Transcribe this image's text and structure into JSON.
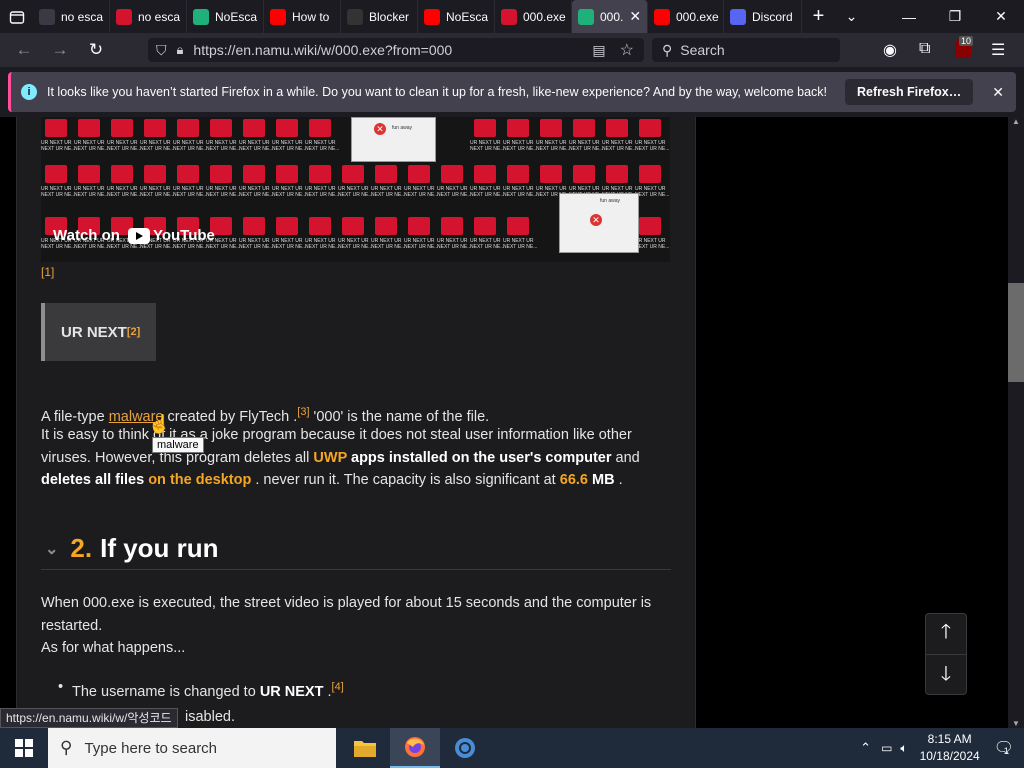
{
  "tabs": [
    {
      "label": "no esca",
      "color": "#3a3a44",
      "icon": "search-icon"
    },
    {
      "label": "no esca",
      "color": "#d4142e",
      "icon": "namu-icon"
    },
    {
      "label": "NoEsca",
      "color": "#20b07a",
      "icon": "noesc-icon"
    },
    {
      "label": "How to",
      "color": "#ff0000",
      "icon": "youtube-icon"
    },
    {
      "label": "Blocker",
      "color": "#333",
      "icon": "blocker-icon"
    },
    {
      "label": "NoEsca",
      "color": "#ff0000",
      "icon": "youtube-icon"
    },
    {
      "label": "000.exe",
      "color": "#d4142e",
      "icon": "namu-icon"
    },
    {
      "label": "000.",
      "color": "#20b07a",
      "icon": "noesc-icon",
      "active": true
    },
    {
      "label": "000.exe",
      "color": "#ff0000",
      "icon": "youtube-icon"
    },
    {
      "label": "Discord",
      "color": "#5865f2",
      "icon": "discord-icon"
    }
  ],
  "url": "https://en.namu.wiki/w/000.exe?from=000",
  "url_host": "namu.wiki",
  "search_placeholder": "Search",
  "extension_badge": "10",
  "notification": {
    "text": "It looks like you haven’t started Firefox in a while. Do you want to clean it up for a fresh, like-new experience? And by the way, welcome back!",
    "button": "Refresh Firefox…"
  },
  "video": {
    "watch_on": "Watch on",
    "youtube": "YouTube",
    "tile_label": "UR NEXT UR NEXT UR NE...",
    "dialog_text": "fun away"
  },
  "footnote1": "[1]",
  "urnext": {
    "title": "UR NEXT",
    "fn": "[2]"
  },
  "para1": {
    "a": "A file-type ",
    "link": "malware",
    "b": " created by FlyTech .",
    "fn": "[3]",
    "c": " '000' is the name of the file."
  },
  "para2": {
    "a": "It is easy to think of it as a joke program because it does not steal user information like other viruses. However, this program deletes all ",
    "uwp": "UWP",
    "b": " apps installed on the user's computer",
    "c": " and ",
    "d": "deletes all files",
    "e": " on the desktop",
    "f": " . never run it. The capacity is also significant at ",
    "g": "66.6",
    "h": " MB",
    "i": " ."
  },
  "tooltip": "malware",
  "heading": {
    "num": "2.",
    "title": "If you run"
  },
  "para3": {
    "a": "When 000.exe is executed, the street video is played for about 15 seconds and the computer is restarted.",
    "b": "As for what happens..."
  },
  "bullet1": {
    "a": "The username is changed to ",
    "b": "UR NEXT",
    "c": " .",
    "fn": "[4]"
  },
  "bullet2_tail": "isabled.",
  "status_url": "https://en.namu.wiki/w/악성코드",
  "taskbar": {
    "search_placeholder": "Type here to search",
    "time": "8:15 AM",
    "date": "10/18/2024",
    "notif_count": "1"
  }
}
